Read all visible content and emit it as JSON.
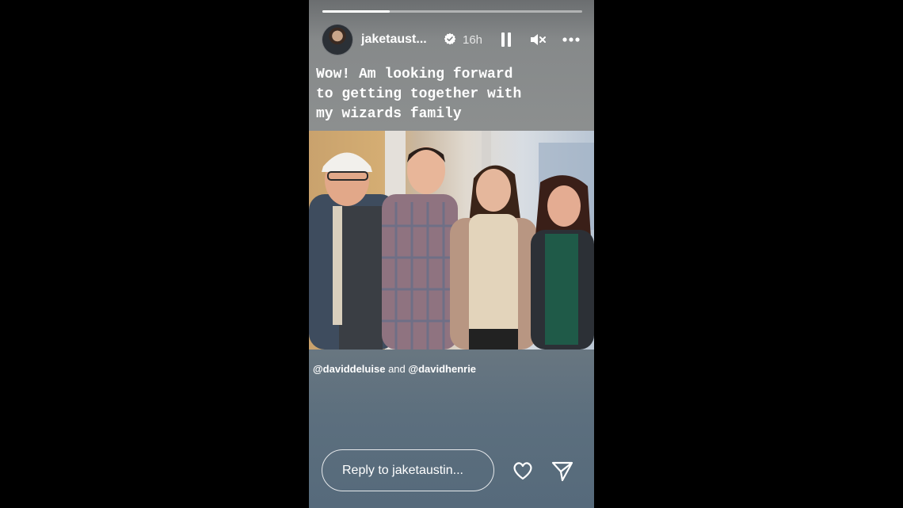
{
  "story": {
    "progress": 0.26,
    "username": "jaketaust...",
    "verified": true,
    "time_ago": "16h",
    "caption": "Wow! Am looking forward\nto getting together with\nmy wizards family",
    "mention1": "@daviddeluise",
    "mention_joiner": "and",
    "mention2": "@davidhenrie",
    "reply_placeholder": "Reply to jaketaustin...",
    "icons": [
      "pause-icon",
      "mute-icon",
      "more-icon",
      "heart-icon",
      "send-icon",
      "verified-badge-icon"
    ]
  }
}
